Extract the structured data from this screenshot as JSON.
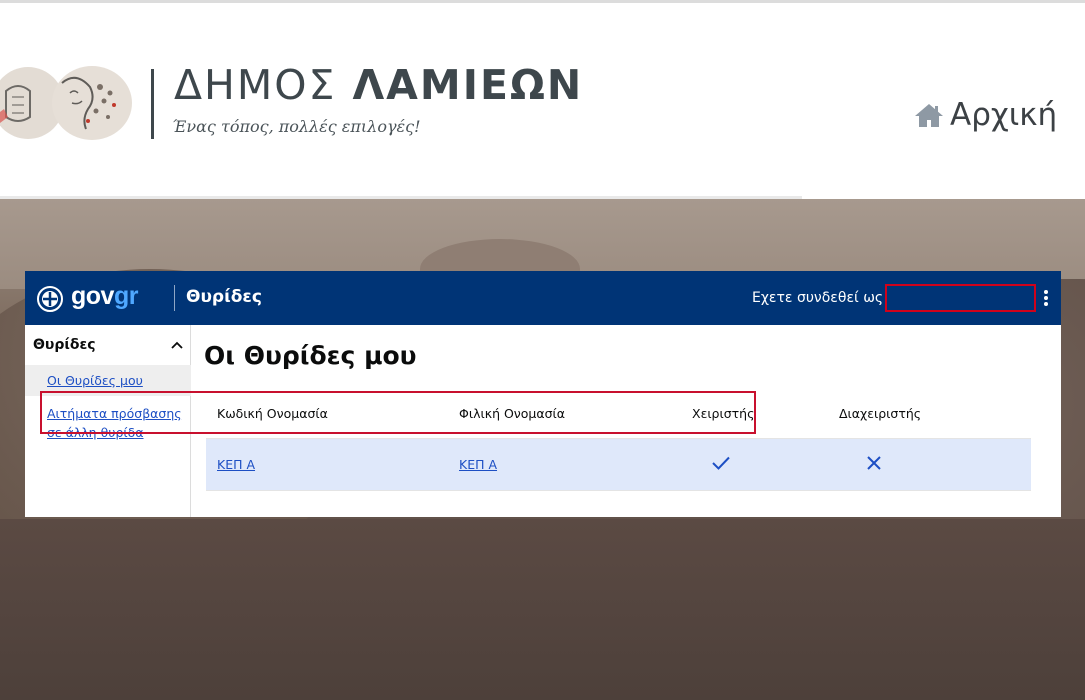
{
  "site": {
    "title_light": "ΔΗΜΟΣ",
    "title_bold": "ΛΑΜΙΕΩΝ",
    "slogan": "Ένας τόπος, πολλές επιλογές!",
    "home_label": "Αρχική"
  },
  "gov": {
    "logo_gov": "gov",
    "logo_gr": "gr",
    "app_title": "Θυρίδες",
    "logged_in_label": "Εχετε συνδεθεί ως",
    "user_value": ""
  },
  "sidebar": {
    "heading": "Θυρίδες",
    "items": [
      {
        "label": "Οι Θυρίδες μου"
      },
      {
        "label": "Αιτήματα πρόσβασης σε άλλη θυρίδα"
      }
    ]
  },
  "main": {
    "title": "Οι Θυρίδες μου",
    "columns": [
      "Κωδική Ονομασία",
      "Φιλική Ονομασία",
      "Χειριστής",
      "Διαχειριστής"
    ],
    "rows": [
      {
        "code_name": "ΚΕΠ Α",
        "friendly_name": "ΚΕΠ Α",
        "operator": "check-icon",
        "admin": "x-icon"
      }
    ]
  },
  "colors": {
    "gov_blue": "#003476",
    "link_blue": "#1d4fc4",
    "highlight_red": "#c8102e",
    "row_selected": "#dfe8fa"
  }
}
